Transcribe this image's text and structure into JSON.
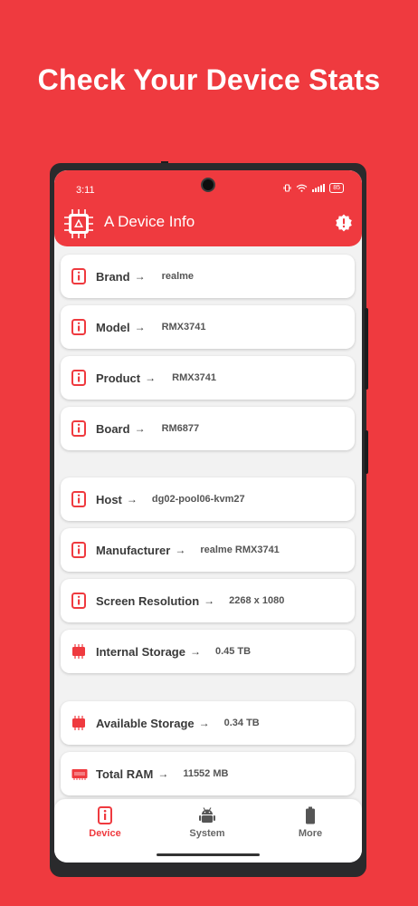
{
  "headline": "Check Your Device Stats",
  "status_bar": {
    "time": "3:11",
    "battery": "85"
  },
  "app": {
    "title": "A Device Info"
  },
  "colors": {
    "accent": "#ef3a3f",
    "card_bg": "#ffffff",
    "screen_bg": "#f2f2f2"
  },
  "cards": [
    {
      "icon": "info-icon",
      "label": "Brand",
      "arrow": "→",
      "value": "realme"
    },
    {
      "icon": "info-icon",
      "label": "Model",
      "arrow": "→",
      "value": "RMX3741"
    },
    {
      "icon": "info-icon",
      "label": "Product",
      "arrow": "→",
      "value": "RMX3741"
    },
    {
      "icon": "info-icon",
      "label": "Board",
      "arrow": "→",
      "value": "RM6877"
    },
    {
      "icon": "info-icon",
      "label": "Host",
      "arrow": "→",
      "value": "dg02-pool06-kvm27"
    },
    {
      "icon": "info-icon",
      "label": "Manufacturer",
      "arrow": "→",
      "value": "realme RMX3741"
    },
    {
      "icon": "info-icon",
      "label": "Screen Resolution",
      "arrow": "→",
      "value": "2268 x 1080"
    },
    {
      "icon": "storage-icon",
      "label": "Internal Storage",
      "arrow": "→",
      "value": "0.45 TB"
    },
    {
      "icon": "storage-icon",
      "label": "Available Storage",
      "arrow": "→",
      "value": "0.34 TB"
    },
    {
      "icon": "ram-icon",
      "label": "Total RAM",
      "arrow": "→",
      "value": "11552 MB"
    }
  ],
  "nav": {
    "device": {
      "label": "Device",
      "icon": "device-icon",
      "active": true
    },
    "system": {
      "label": "System",
      "icon": "android-icon"
    },
    "more": {
      "label": "More",
      "icon": "battery-icon"
    }
  }
}
